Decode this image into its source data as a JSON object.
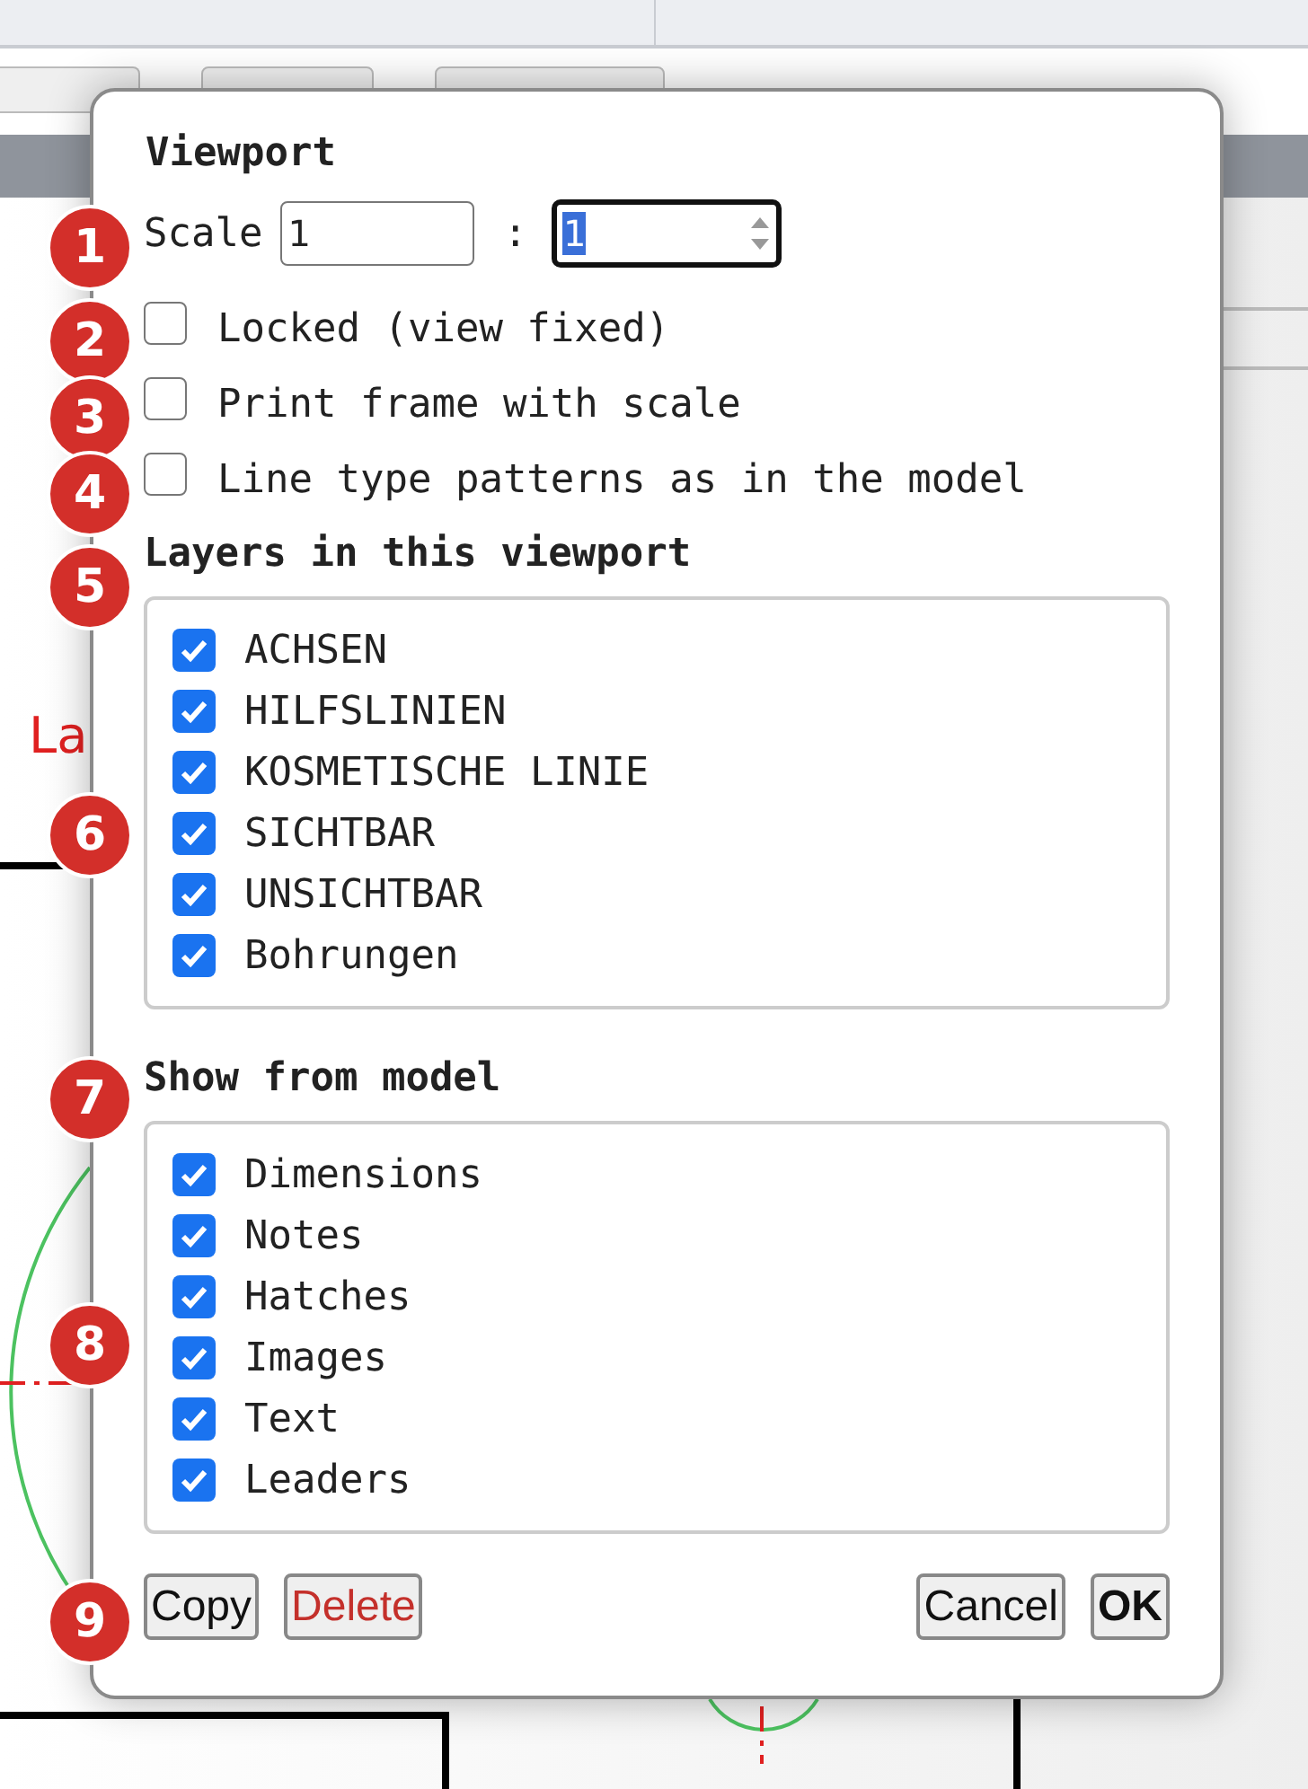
{
  "background": {
    "drawing_label": "La"
  },
  "dialog": {
    "title": "Viewport",
    "scale": {
      "label": "Scale",
      "numerator": "1",
      "separator": ":",
      "denominator": "1",
      "denominator_focused": true
    },
    "options": [
      {
        "label": "Locked (view fixed)",
        "checked": false
      },
      {
        "label": "Print frame with scale",
        "checked": false
      },
      {
        "label": "Line type patterns as in the model",
        "checked": false
      }
    ],
    "layers": {
      "title": "Layers in this viewport",
      "items": [
        {
          "label": "ACHSEN",
          "checked": true
        },
        {
          "label": "HILFSLINIEN",
          "checked": true
        },
        {
          "label": "KOSMETISCHE LINIE",
          "checked": true
        },
        {
          "label": "SICHTBAR",
          "checked": true
        },
        {
          "label": "UNSICHTBAR",
          "checked": true
        },
        {
          "label": "Bohrungen",
          "checked": true
        }
      ]
    },
    "show_from_model": {
      "title": "Show from model",
      "items": [
        {
          "label": "Dimensions",
          "checked": true
        },
        {
          "label": "Notes",
          "checked": true
        },
        {
          "label": "Hatches",
          "checked": true
        },
        {
          "label": "Images",
          "checked": true
        },
        {
          "label": "Text",
          "checked": true
        },
        {
          "label": "Leaders",
          "checked": true
        }
      ]
    },
    "buttons": [
      {
        "label": "Copy",
        "kind": "normal"
      },
      {
        "label": "Delete",
        "kind": "danger"
      },
      {
        "label": "Cancel",
        "kind": "normal"
      },
      {
        "label": "OK",
        "kind": "default"
      }
    ]
  },
  "markers": [
    "1",
    "2",
    "3",
    "4",
    "5",
    "6",
    "7",
    "8",
    "9"
  ]
}
